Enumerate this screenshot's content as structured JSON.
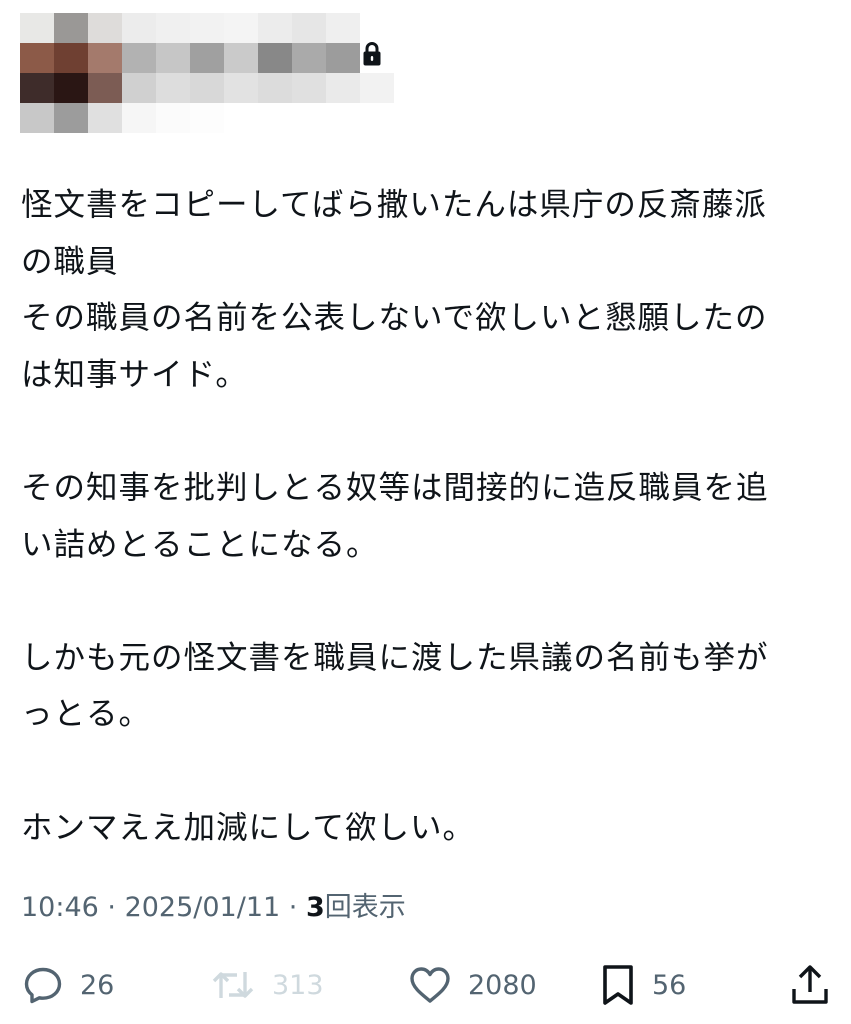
{
  "header": {
    "pixel_colors": [
      "#e8e8e6",
      "#9a9896",
      "#dedcda",
      "#ececec",
      "#f0f0f0",
      "#f2f2f2",
      "#f4f4f4",
      "#ececec",
      "#e6e6e6",
      "#efefef",
      "#ffffff",
      "#8c5a48",
      "#6f4032",
      "#a47a6c",
      "#b2b2b2",
      "#c6c6c6",
      "#a0a0a0",
      "#cacaca",
      "#888888",
      "#aaaaaa",
      "#9c9c9c",
      "#ffffff",
      "#3e2c2a",
      "#2a1614",
      "#7c5c54",
      "#d0d0d0",
      "#dddddd",
      "#d8d8d8",
      "#e2e2e2",
      "#dcdcdc",
      "#e0e0e0",
      "#eaeaea",
      "#f2f2f2",
      "#c8c8c8",
      "#9c9c9c",
      "#e0e0e0",
      "#f6f6f6",
      "#fbfbfb",
      "#fdfdfd",
      "#ffffff",
      "#ffffff",
      "#ffffff",
      "#ffffff",
      "#ffffff"
    ],
    "lock_icon": "lock-icon"
  },
  "tweet": {
    "text": "怪文書をコピーしてばら撒いたんは県庁の反斎藤派\nの職員\nその職員の名前を公表しないで欲しいと懇願したの\nは知事サイド。\n\nその知事を批判しとる奴等は間接的に造反職員を追\nい詰めとることになる。\n\nしかも元の怪文書を職員に渡した県議の名前も挙が\nっとる。\n\nホンマええ加減にして欲しい。",
    "time": "10:46",
    "date": "2025/01/11",
    "separator": " · ",
    "views_count": "3",
    "views_label": "回表示"
  },
  "actions": {
    "reply": {
      "icon": "reply-icon",
      "count": "26"
    },
    "retweet": {
      "icon": "retweet-icon",
      "count": "313"
    },
    "like": {
      "icon": "heart-icon",
      "count": "2080"
    },
    "bookmark": {
      "icon": "bookmark-icon",
      "count": "56"
    },
    "share": {
      "icon": "share-icon"
    }
  },
  "colors": {
    "text": "#0f1419",
    "secondary": "#536471",
    "disabled": "#cfd9de"
  }
}
